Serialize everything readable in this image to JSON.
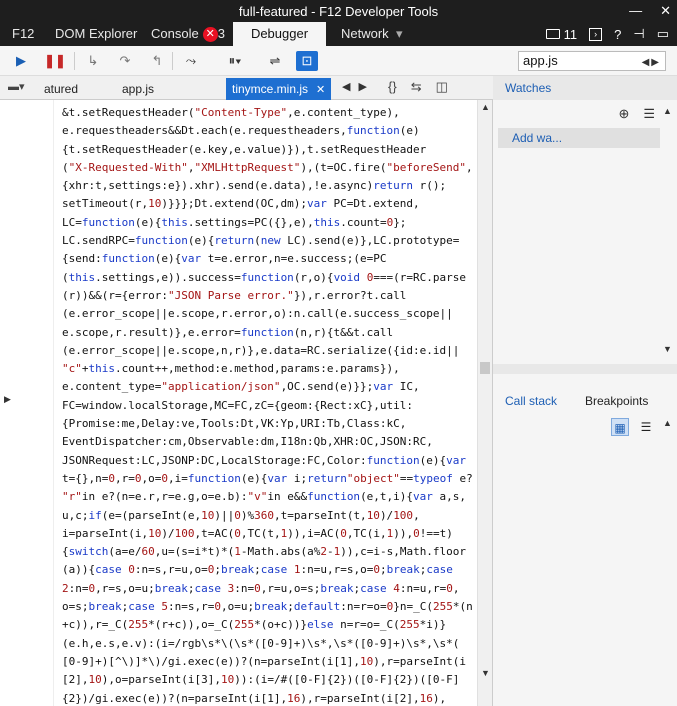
{
  "window": {
    "title": "full-featured - F12 Developer Tools",
    "minimize": "—",
    "close": "✕"
  },
  "tools": {
    "f12": "F12",
    "dom_explorer": "DOM Explorer",
    "console": "Console",
    "console_errors": "3",
    "debugger": "Debugger",
    "network": "Network",
    "emulation_count": "11",
    "help": "?"
  },
  "search": {
    "value": "app.js"
  },
  "doc_tabs": [
    {
      "label": "atured",
      "active": false
    },
    {
      "label": "app.js",
      "active": false
    },
    {
      "label": "tinymce.min.js",
      "active": true
    }
  ],
  "code_lines": [
    [
      {
        "t": "&t.setRequestHeader("
      },
      {
        "t": "\"Content-Type\"",
        "c": "s"
      },
      {
        "t": ",e.content_type),"
      }
    ],
    [
      {
        "t": "e.requestheaders&&Dt.each(e.requestheaders,"
      },
      {
        "t": "function",
        "c": "k"
      },
      {
        "t": "(e)"
      }
    ],
    [
      {
        "t": "{t.setRequestHeader(e.key,e.value)}),t.setRequestHeader"
      }
    ],
    [
      {
        "t": "("
      },
      {
        "t": "\"X-Requested-With\"",
        "c": "s"
      },
      {
        "t": ","
      },
      {
        "t": "\"XMLHttpRequest\"",
        "c": "s"
      },
      {
        "t": "),(t=OC.fire("
      },
      {
        "t": "\"beforeSend\"",
        "c": "s"
      },
      {
        "t": ","
      }
    ],
    [
      {
        "t": "{xhr:t,settings:e}).xhr).send(e.data),!e.async)"
      },
      {
        "t": "return",
        "c": "k"
      },
      {
        "t": " r();"
      }
    ],
    [
      {
        "t": "setTimeout(r,"
      },
      {
        "t": "10",
        "c": "s"
      },
      {
        "t": ")}}};Dt.extend(OC,dm);"
      },
      {
        "t": "var",
        "c": "k"
      },
      {
        "t": " PC=Dt.extend,"
      }
    ],
    [
      {
        "t": "LC="
      },
      {
        "t": "function",
        "c": "k"
      },
      {
        "t": "(e){"
      },
      {
        "t": "this",
        "c": "k"
      },
      {
        "t": ".settings=PC({},e),"
      },
      {
        "t": "this",
        "c": "k"
      },
      {
        "t": ".count="
      },
      {
        "t": "0",
        "c": "s"
      },
      {
        "t": "};"
      }
    ],
    [
      {
        "t": "LC.sendRPC="
      },
      {
        "t": "function",
        "c": "k"
      },
      {
        "t": "(e){"
      },
      {
        "t": "return",
        "c": "k"
      },
      {
        "t": "("
      },
      {
        "t": "new",
        "c": "k"
      },
      {
        "t": " LC).send(e)},LC.prototype="
      }
    ],
    [
      {
        "t": "{send:"
      },
      {
        "t": "function",
        "c": "k"
      },
      {
        "t": "(e){"
      },
      {
        "t": "var",
        "c": "k"
      },
      {
        "t": " t=e.error,n=e.success;(e=PC"
      }
    ],
    [
      {
        "t": "("
      },
      {
        "t": "this",
        "c": "k"
      },
      {
        "t": ".settings,e)).success="
      },
      {
        "t": "function",
        "c": "k"
      },
      {
        "t": "(r,o){"
      },
      {
        "t": "void",
        "c": "k"
      },
      {
        "t": " "
      },
      {
        "t": "0",
        "c": "s"
      },
      {
        "t": "===(r=RC.parse"
      }
    ],
    [
      {
        "t": "(r))&&(r={error:"
      },
      {
        "t": "\"JSON Parse error.\"",
        "c": "s"
      },
      {
        "t": "}),r.error?t.call"
      }
    ],
    [
      {
        "t": "(e.error_scope||e.scope,r.error,o):n.call(e.success_scope||"
      }
    ],
    [
      {
        "t": "e.scope,r.result)},e.error="
      },
      {
        "t": "function",
        "c": "k"
      },
      {
        "t": "(n,r){t&&t.call"
      }
    ],
    [
      {
        "t": "(e.error_scope||e.scope,n,r)},e.data=RC.serialize({id:e.id||"
      }
    ],
    [
      {
        "t": "\"c\"",
        "c": "s"
      },
      {
        "t": "+"
      },
      {
        "t": "this",
        "c": "k"
      },
      {
        "t": ".count++,method:e.method,params:e.params}),"
      }
    ],
    [
      {
        "t": "e.content_type="
      },
      {
        "t": "\"application/json\"",
        "c": "s"
      },
      {
        "t": ",OC.send(e)}};"
      },
      {
        "t": "var",
        "c": "k"
      },
      {
        "t": " IC,"
      }
    ],
    [
      {
        "t": "FC=window.localStorage,MC=FC,zC={geom:{Rect:xC},util:"
      }
    ],
    [
      {
        "t": "{Promise:me,Delay:ve,Tools:Dt,VK:Yp,URI:Tb,Class:kC,"
      }
    ],
    [
      {
        "t": "EventDispatcher:cm,Observable:dm,I18n:Qb,XHR:OC,JSON:RC,"
      }
    ],
    [
      {
        "t": "JSONRequest:LC,JSONP:DC,LocalStorage:FC,Color:"
      },
      {
        "t": "function",
        "c": "k"
      },
      {
        "t": "(e){"
      },
      {
        "t": "var",
        "c": "k"
      }
    ],
    [
      {
        "t": "t={},n="
      },
      {
        "t": "0",
        "c": "s"
      },
      {
        "t": ",r="
      },
      {
        "t": "0",
        "c": "s"
      },
      {
        "t": ",o="
      },
      {
        "t": "0",
        "c": "s"
      },
      {
        "t": ",i="
      },
      {
        "t": "function",
        "c": "k"
      },
      {
        "t": "(e){"
      },
      {
        "t": "var",
        "c": "k"
      },
      {
        "t": " i;"
      },
      {
        "t": "return",
        "c": "k"
      },
      {
        "t": ""
      },
      {
        "t": "\"object\"",
        "c": "s"
      },
      {
        "t": "=="
      },
      {
        "t": "typeof",
        "c": "k"
      },
      {
        "t": " e?"
      }
    ],
    [
      {
        "t": "\"r\"",
        "c": "s"
      },
      {
        "t": "in e?(n=e.r,r=e.g,o=e.b):"
      },
      {
        "t": "\"v\"",
        "c": "s"
      },
      {
        "t": "in e&&"
      },
      {
        "t": "function",
        "c": "k"
      },
      {
        "t": "(e,t,i){"
      },
      {
        "t": "var",
        "c": "k"
      },
      {
        "t": " a,s,"
      }
    ],
    [
      {
        "t": "u,c;"
      },
      {
        "t": "if",
        "c": "k"
      },
      {
        "t": "(e=(parseInt(e,"
      },
      {
        "t": "10",
        "c": "s"
      },
      {
        "t": ")||"
      },
      {
        "t": "0",
        "c": "s"
      },
      {
        "t": ")%"
      },
      {
        "t": "360",
        "c": "s"
      },
      {
        "t": ",t=parseInt(t,"
      },
      {
        "t": "10",
        "c": "s"
      },
      {
        "t": ")/"
      },
      {
        "t": "100",
        "c": "s"
      },
      {
        "t": ","
      }
    ],
    [
      {
        "t": "i=parseInt(i,"
      },
      {
        "t": "10",
        "c": "s"
      },
      {
        "t": ")/"
      },
      {
        "t": "100",
        "c": "s"
      },
      {
        "t": ",t=AC("
      },
      {
        "t": "0",
        "c": "s"
      },
      {
        "t": ",TC(t,"
      },
      {
        "t": "1",
        "c": "s"
      },
      {
        "t": ")),i=AC("
      },
      {
        "t": "0",
        "c": "s"
      },
      {
        "t": ",TC(i,"
      },
      {
        "t": "1",
        "c": "s"
      },
      {
        "t": ")),"
      },
      {
        "t": "0",
        "c": "s"
      },
      {
        "t": "!==t)"
      }
    ],
    [
      {
        "t": "{"
      },
      {
        "t": "switch",
        "c": "k"
      },
      {
        "t": "(a=e/"
      },
      {
        "t": "60",
        "c": "s"
      },
      {
        "t": ",u=(s=i*t)*("
      },
      {
        "t": "1",
        "c": "s"
      },
      {
        "t": "-Math.abs(a%"
      },
      {
        "t": "2",
        "c": "s"
      },
      {
        "t": "-"
      },
      {
        "t": "1",
        "c": "s"
      },
      {
        "t": ")),c=i-s,Math.floor"
      }
    ],
    [
      {
        "t": "(a)){"
      },
      {
        "t": "case",
        "c": "k"
      },
      {
        "t": " "
      },
      {
        "t": "0",
        "c": "s"
      },
      {
        "t": ":n=s,r=u,o="
      },
      {
        "t": "0",
        "c": "s"
      },
      {
        "t": ";"
      },
      {
        "t": "break",
        "c": "k"
      },
      {
        "t": ";"
      },
      {
        "t": "case",
        "c": "k"
      },
      {
        "t": " "
      },
      {
        "t": "1",
        "c": "s"
      },
      {
        "t": ":n=u,r=s,o="
      },
      {
        "t": "0",
        "c": "s"
      },
      {
        "t": ";"
      },
      {
        "t": "break",
        "c": "k"
      },
      {
        "t": ";"
      },
      {
        "t": "case",
        "c": "k"
      }
    ],
    [
      {
        "t": "2",
        "c": "s"
      },
      {
        "t": ":n="
      },
      {
        "t": "0",
        "c": "s"
      },
      {
        "t": ",r=s,o=u;"
      },
      {
        "t": "break",
        "c": "k"
      },
      {
        "t": ";"
      },
      {
        "t": "case",
        "c": "k"
      },
      {
        "t": " "
      },
      {
        "t": "3",
        "c": "s"
      },
      {
        "t": ":n="
      },
      {
        "t": "0",
        "c": "s"
      },
      {
        "t": ",r=u,o=s;"
      },
      {
        "t": "break",
        "c": "k"
      },
      {
        "t": ";"
      },
      {
        "t": "case",
        "c": "k"
      },
      {
        "t": " "
      },
      {
        "t": "4",
        "c": "s"
      },
      {
        "t": ":n=u,r="
      },
      {
        "t": "0",
        "c": "s"
      },
      {
        "t": ","
      }
    ],
    [
      {
        "t": "o=s;"
      },
      {
        "t": "break",
        "c": "k"
      },
      {
        "t": ";"
      },
      {
        "t": "case",
        "c": "k"
      },
      {
        "t": " "
      },
      {
        "t": "5",
        "c": "s"
      },
      {
        "t": ":n=s,r="
      },
      {
        "t": "0",
        "c": "s"
      },
      {
        "t": ",o=u;"
      },
      {
        "t": "break",
        "c": "k"
      },
      {
        "t": ";"
      },
      {
        "t": "default",
        "c": "k"
      },
      {
        "t": ":n=r=o="
      },
      {
        "t": "0",
        "c": "s"
      },
      {
        "t": "}n=_C("
      },
      {
        "t": "255",
        "c": "s"
      },
      {
        "t": "*(n"
      }
    ],
    [
      {
        "t": "+c)),r=_C("
      },
      {
        "t": "255",
        "c": "s"
      },
      {
        "t": "*(r+c)),o=_C("
      },
      {
        "t": "255",
        "c": "s"
      },
      {
        "t": "*(o+c))}"
      },
      {
        "t": "else",
        "c": "k"
      },
      {
        "t": " n=r=o=_C("
      },
      {
        "t": "255",
        "c": "s"
      },
      {
        "t": "*i)}"
      }
    ],
    [
      {
        "t": "(e.h,e.s,e.v):(i=/rgb\\s*\\(\\s*([0-9]+)\\s*,\\s*([0-9]+)\\s*,\\s*("
      }
    ],
    [
      {
        "t": "[0-9]+)[^\\)]*\\)/gi.exec(e))?(n=parseInt(i[1],"
      },
      {
        "t": "10",
        "c": "s"
      },
      {
        "t": "),r=parseInt(i"
      }
    ],
    [
      {
        "t": "[2],"
      },
      {
        "t": "10",
        "c": "s"
      },
      {
        "t": "),o=parseInt(i[3],"
      },
      {
        "t": "10",
        "c": "s"
      },
      {
        "t": ")):(i=/#([0-F]{2})([0-F]{2})([0-F]"
      }
    ],
    [
      {
        "t": "{2})/gi.exec(e))?(n=parseInt(i[1],"
      },
      {
        "t": "16",
        "c": "s"
      },
      {
        "t": "),r=parseInt(i[2],"
      },
      {
        "t": "16",
        "c": "s"
      },
      {
        "t": "),"
      }
    ]
  ],
  "watches": {
    "title": "Watches",
    "add_watch": "Add wa..."
  },
  "callstack": {
    "tab_callstack": "Call stack",
    "tab_breakpoints": "Breakpoints"
  }
}
